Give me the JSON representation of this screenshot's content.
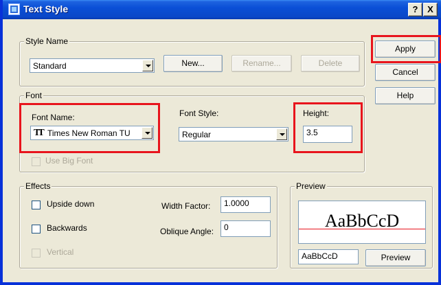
{
  "window": {
    "title": "Text Style",
    "help_button": "?",
    "close_button": "X"
  },
  "style_name": {
    "group_title": "Style Name",
    "selected": "Standard",
    "new_label": "New...",
    "rename_label": "Rename...",
    "delete_label": "Delete"
  },
  "side_buttons": {
    "apply": "Apply",
    "cancel": "Cancel",
    "help": "Help"
  },
  "font": {
    "group_title": "Font",
    "font_name_label": "Font Name:",
    "font_name_value": "Times New Roman TU",
    "font_name_icon": "truetype-font-icon",
    "font_style_label": "Font Style:",
    "font_style_value": "Regular",
    "height_label": "Height:",
    "height_value": "3.5",
    "big_font_label": "Use Big Font"
  },
  "effects": {
    "group_title": "Effects",
    "upside_down": "Upside down",
    "backwards": "Backwards",
    "vertical": "Vertical",
    "width_factor_label": "Width Factor:",
    "width_factor_value": "1.0000",
    "oblique_angle_label": "Oblique Angle:",
    "oblique_angle_value": "0"
  },
  "preview": {
    "group_title": "Preview",
    "sample_text": "AaBbCcD",
    "input_value": "AaBbCcD",
    "button_label": "Preview"
  },
  "colors": {
    "highlight": "#e8141c",
    "titlebar": "#0a4fd6",
    "dialog_bg": "#ece9d8"
  }
}
